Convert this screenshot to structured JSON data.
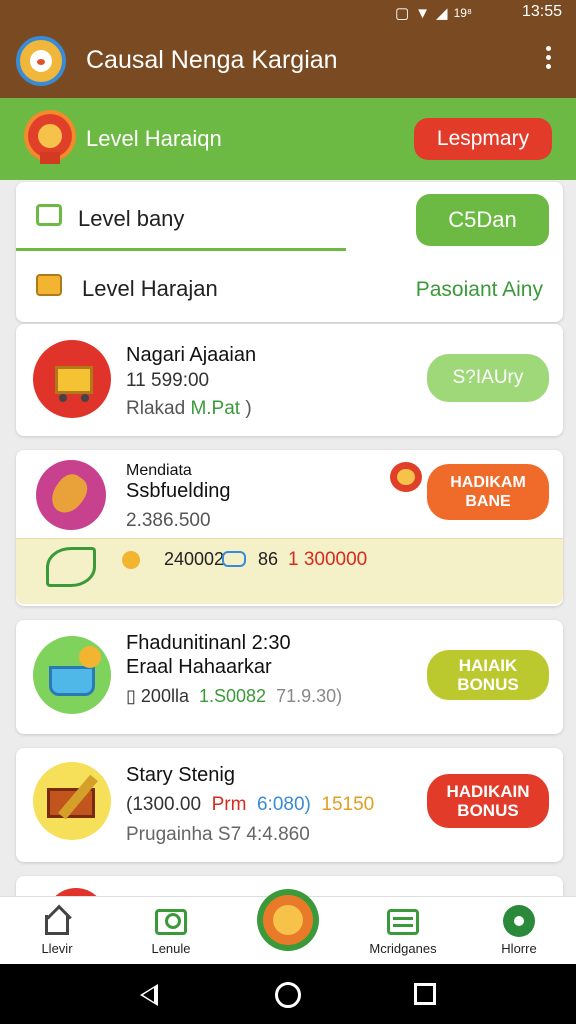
{
  "status_bar": {
    "signal": "19⁸",
    "time": "13:55"
  },
  "app_bar": {
    "title": "Causal Nenga Kargian"
  },
  "level_banner": {
    "title": "Level Haraiqn",
    "button": "Lespmary"
  },
  "tabs": {
    "row1": {
      "label": "Level bany",
      "button": "C5Dan"
    },
    "row2": {
      "label": "Level Harajan",
      "link": "Pasoiant Ainy"
    }
  },
  "items": [
    {
      "title": "Nagari Ajaaian",
      "line1": "11 599:00",
      "line2_prefix": "Rlakad",
      "line2_green": "M.Pat",
      "line2_suffix": ")",
      "button": "S?IAUry"
    },
    {
      "title_small": "Mendiata",
      "title": "Ssbfuelding",
      "line1": "2.386.500",
      "button": "HADIKAM BANE",
      "strip": {
        "a": "240002",
        "b": "86",
        "c": "1 300000"
      }
    },
    {
      "title": "Fhadunitinanl 2:30",
      "line1": "Eraal Hahaarkar",
      "line2_a": "200lla",
      "line2_green": "1.S0082",
      "line2_grey": "71.9.30)",
      "button": "HAIAIK BONUS"
    },
    {
      "title": "Stary Stenig",
      "line1_a": "(1300.00",
      "line1_red": "Prm",
      "line1_blue": "6:080)",
      "line1_yellow": "15150",
      "line2": "Prugainha S7 4:4.860",
      "button": "HADIKAIN BONUS"
    }
  ],
  "bottom_nav": [
    {
      "label": "Llevir"
    },
    {
      "label": "Lenule"
    },
    {
      "label": ""
    },
    {
      "label": "Mcridganes"
    },
    {
      "label": "Hlorre"
    }
  ],
  "colors": {
    "appbar": "#7a4a22",
    "green": "#6cba44",
    "red": "#e23b2a",
    "orange": "#f06a2a",
    "yellow_green": "#bcc92e",
    "light_green": "#9ed878"
  }
}
